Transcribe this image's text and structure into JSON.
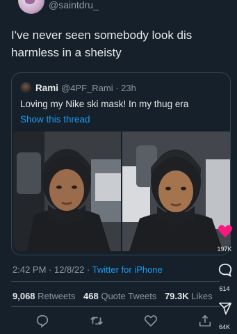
{
  "author": {
    "handle": "@saintdru_"
  },
  "tweet": {
    "text": "I've never seen somebody look dis harmless in a sheisty"
  },
  "quoted": {
    "name": "Rami",
    "handle_time": "@4PF_Rami · 23h",
    "text": "Loving my Nike ski mask! In my thug era",
    "thread_link": "Show this thread"
  },
  "meta": {
    "time_date": "2:42 PM · 12/8/22 · ",
    "source": "Twitter for iPhone"
  },
  "stats": {
    "retweets_count": "9,068",
    "retweets_label": "Retweets",
    "quotes_count": "468",
    "quotes_label": "Quote Tweets",
    "likes_count": "79.3K",
    "likes_label": "Likes"
  },
  "overlay": {
    "likes": "197K",
    "comments": "614",
    "shares": "64K"
  },
  "colors": {
    "background": "#15202b",
    "accent": "#1d9bf0",
    "secondary_text": "#8b98a5",
    "border": "#38444d",
    "heart": "#f91880"
  },
  "icons": [
    "reply-icon",
    "retweet-icon",
    "like-icon",
    "share-icon",
    "comment-bubble-icon",
    "send-icon",
    "heart-icon"
  ]
}
